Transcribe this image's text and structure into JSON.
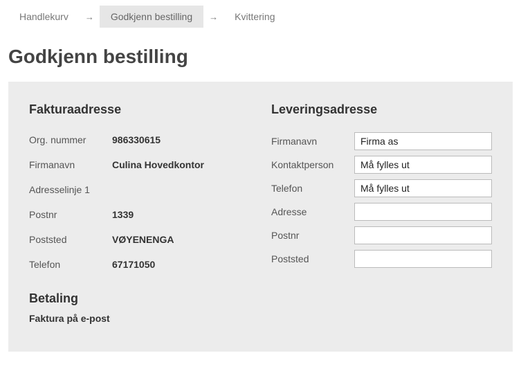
{
  "breadcrumb": {
    "step1": "Handlekurv",
    "step2": "Godkjenn bestilling",
    "step3": "Kvittering"
  },
  "page_title": "Godkjenn bestilling",
  "billing": {
    "heading": "Fakturaadresse",
    "org_label": "Org. nummer",
    "org_value": "986330615",
    "company_label": "Firmanavn",
    "company_value": "Culina Hovedkontor",
    "address1_label": "Adresselinje 1",
    "address1_value": "",
    "postnr_label": "Postnr",
    "postnr_value": "1339",
    "poststed_label": "Poststed",
    "poststed_value": "VØYENENGA",
    "telefon_label": "Telefon",
    "telefon_value": "67171050"
  },
  "delivery": {
    "heading": "Leveringsadresse",
    "company_label": "Firmanavn",
    "company_value": "Firma as",
    "contact_label": "Kontaktperson",
    "contact_value": "Må fylles ut",
    "telefon_label": "Telefon",
    "telefon_value": "Må fylles ut",
    "adresse_label": "Adresse",
    "adresse_value": "",
    "postnr_label": "Postnr",
    "postnr_value": "",
    "poststed_label": "Poststed",
    "poststed_value": ""
  },
  "payment": {
    "heading": "Betaling",
    "value": "Faktura på e-post"
  }
}
